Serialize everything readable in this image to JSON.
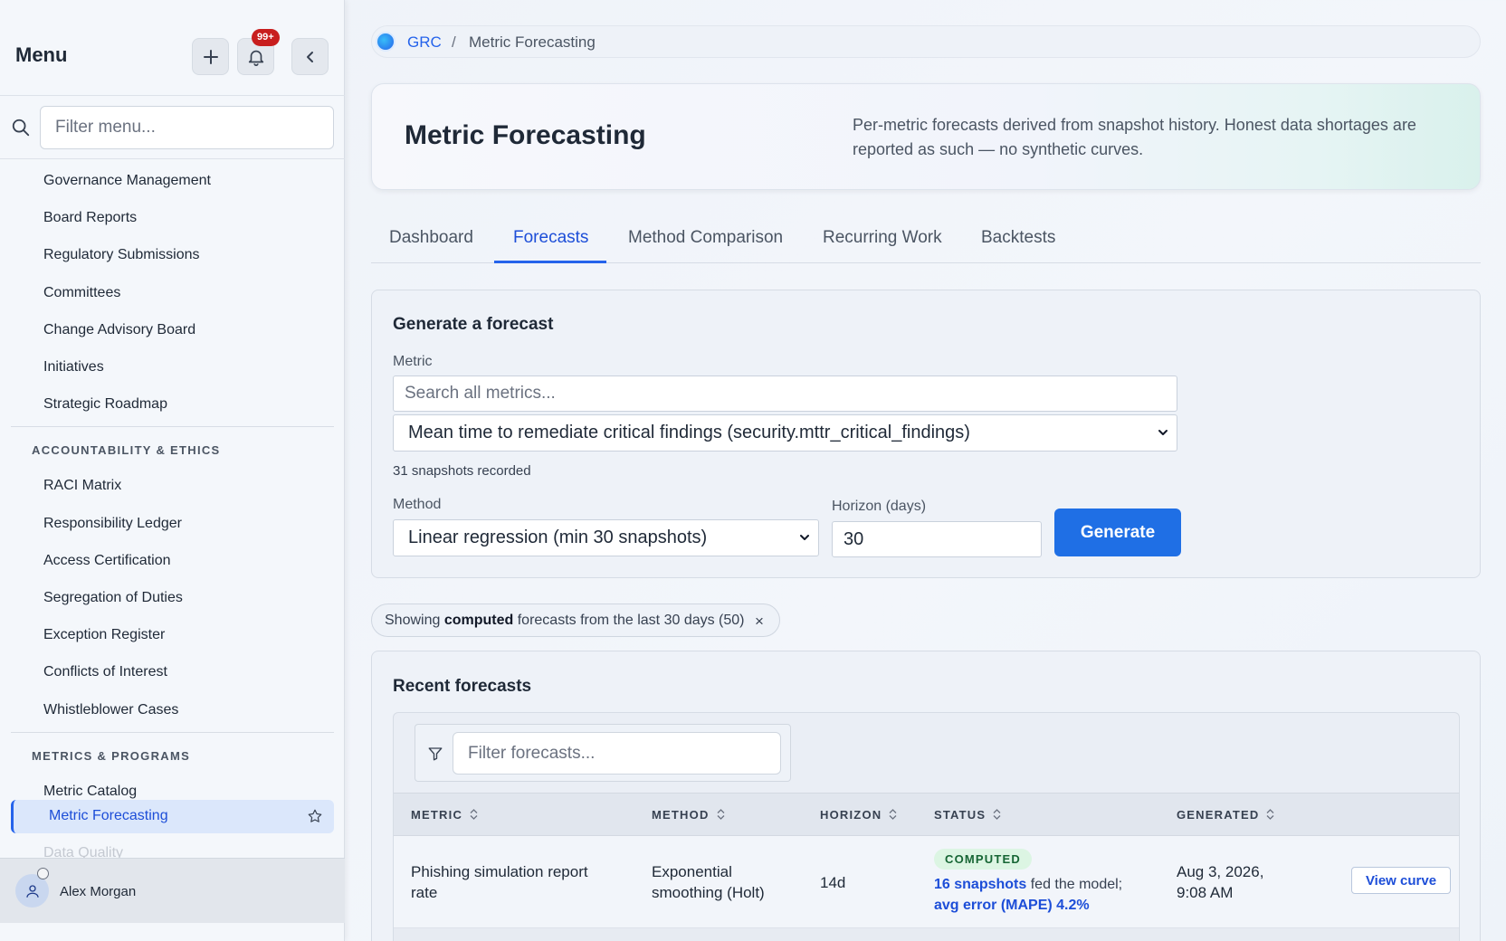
{
  "sidebar": {
    "title": "Menu",
    "notification_badge": "99+",
    "filter_placeholder": "Filter menu...",
    "groups": [
      {
        "items": [
          "Governance Management",
          "Board Reports",
          "Regulatory Submissions",
          "Committees",
          "Change Advisory Board",
          "Initiatives",
          "Strategic Roadmap"
        ]
      },
      {
        "section": "ACCOUNTABILITY & ETHICS",
        "items": [
          "RACI Matrix",
          "Responsibility Ledger",
          "Access Certification",
          "Segregation of Duties",
          "Exception Register",
          "Conflicts of Interest",
          "Whistleblower Cases"
        ]
      },
      {
        "section": "METRICS & PROGRAMS",
        "items": [
          "Metric Catalog"
        ]
      }
    ],
    "active_item": "Metric Forecasting",
    "faded_item": "Data Quality",
    "user_name": "Alex Morgan",
    "active_color": "#2563eb"
  },
  "breadcrumb": {
    "root": "GRC",
    "separator": "/",
    "current": "Metric Forecasting"
  },
  "hero": {
    "title": "Metric Forecasting",
    "description": "Per-metric forecasts derived from snapshot history. Honest data shortages are reported as such — no synthetic curves."
  },
  "tabs": [
    {
      "label": "Dashboard",
      "active": false
    },
    {
      "label": "Forecasts",
      "active": true
    },
    {
      "label": "Method Comparison",
      "active": false
    },
    {
      "label": "Recurring Work",
      "active": false
    },
    {
      "label": "Backtests",
      "active": false
    }
  ],
  "generate": {
    "title": "Generate a forecast",
    "metric_label": "Metric",
    "metric_search_placeholder": "Search all metrics...",
    "metric_selected": "Mean time to remediate critical findings (security.mttr_critical_findings)",
    "snapshot_count": "31 snapshots recorded",
    "method_label": "Method",
    "method_selected": "Linear regression (min 30 snapshots)",
    "horizon_label": "Horizon (days)",
    "horizon_value": "30",
    "button": "Generate"
  },
  "filter_chip": {
    "prefix": "Showing",
    "bold": "computed",
    "suffix": "forecasts from the last 30 days (50)",
    "close": "×"
  },
  "recent": {
    "title": "Recent forecasts",
    "filter_placeholder": "Filter forecasts...",
    "columns": [
      "METRIC",
      "METHOD",
      "HORIZON",
      "STATUS",
      "GENERATED"
    ],
    "rows": [
      {
        "metric": "Phishing simulation report rate",
        "method": "Exponential smoothing (Holt)",
        "horizon": "14d",
        "status": "COMPUTED",
        "snapshots_link": "16 snapshots",
        "snapshots_suffix": "fed the model;",
        "error_link": "avg error (MAPE) 4.2%",
        "generated": "Aug 3, 2026, 9:08 AM",
        "action": "View curve"
      }
    ]
  }
}
